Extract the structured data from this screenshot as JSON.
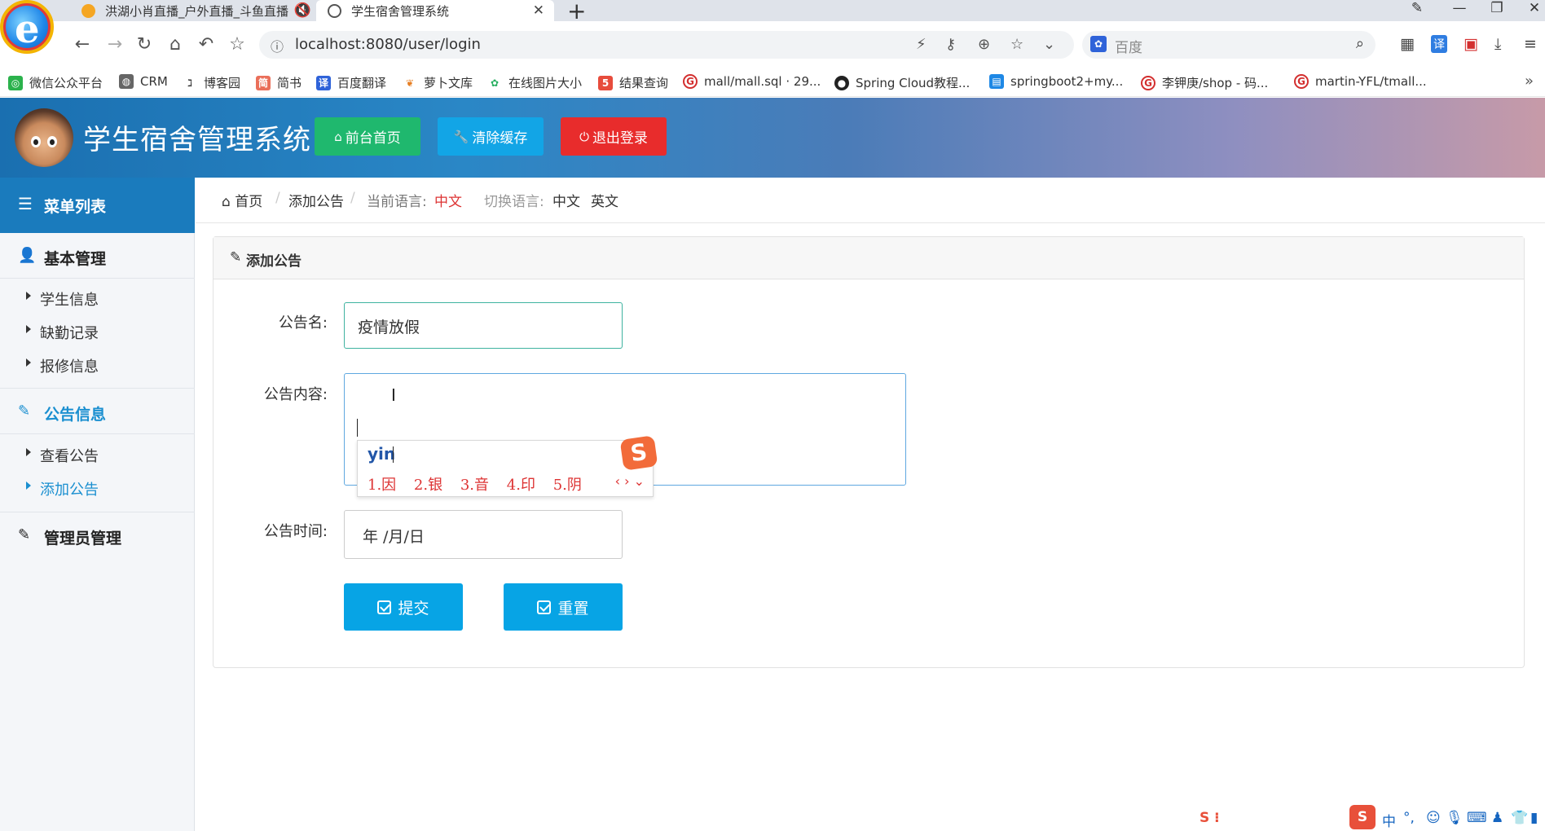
{
  "browser": {
    "tabs": [
      {
        "title": "洪湖小肖直播_户外直播_斗鱼直播",
        "active": false
      },
      {
        "title": "学生宿舍管理系统",
        "active": true
      }
    ],
    "new_tab": "+",
    "url": "localhost:8080/user/login",
    "search_placeholder": "百度",
    "bookmarks": [
      {
        "label": "微信公众平台",
        "icon_color": "#2bb24c"
      },
      {
        "label": "CRM",
        "icon_color": "#666666"
      },
      {
        "label": "博客园",
        "icon_color": "#555555"
      },
      {
        "label": "简书",
        "icon_color": "#ea6f5a"
      },
      {
        "label": "百度翻译",
        "icon_color": "#2f63d9"
      },
      {
        "label": "萝卜文库",
        "icon_color": "#e67e22"
      },
      {
        "label": "在线图片大小",
        "icon_color": "#27ae60"
      },
      {
        "label": "结果查询",
        "icon_color": "#e74c3c"
      },
      {
        "label": "mall/mall.sql · 29...",
        "icon_color": "#d32f2f"
      },
      {
        "label": "Spring Cloud教程...",
        "icon_color": "#222222"
      },
      {
        "label": "springboot2+my...",
        "icon_color": "#1e88e5"
      },
      {
        "label": "李钾庚/shop - 码...",
        "icon_color": "#d32f2f"
      },
      {
        "label": "martin-YFL/tmall...",
        "icon_color": "#d32f2f"
      }
    ],
    "bookmarks_more": "»"
  },
  "header": {
    "title": "学生宿舍管理系统",
    "buttons": [
      {
        "label": "前台首页",
        "color": "#1fb86e",
        "icon": "home-icon"
      },
      {
        "label": "清除缓存",
        "color": "#12a5e6",
        "icon": "wrench-icon"
      },
      {
        "label": "退出登录",
        "color": "#e82c2c",
        "icon": "power-icon"
      }
    ]
  },
  "sidebar": {
    "heading": "菜单列表",
    "groups": [
      {
        "label": "基本管理",
        "icon": "user-icon",
        "items": [
          "学生信息",
          "缺勤记录",
          "报修信息"
        ]
      },
      {
        "label": "公告信息",
        "icon": "edit-icon",
        "active": true,
        "items": [
          "查看公告",
          "添加公告"
        ],
        "active_item": "添加公告"
      },
      {
        "label": "管理员管理",
        "icon": "edit-icon",
        "items": []
      }
    ]
  },
  "breadcrumb": {
    "home": "首页",
    "current": "添加公告",
    "lang_label": "当前语言:",
    "lang_value": "中文",
    "switch_label": "切换语言:",
    "switch_zh": "中文",
    "switch_en": "英文"
  },
  "form": {
    "panel_title": "添加公告",
    "name_label": "公告名:",
    "name_value": "疫情放假",
    "content_label": "公告内容:",
    "content_value": "",
    "time_label": "公告时间:",
    "time_value": "年 /月/日",
    "submit_label": "提交",
    "reset_label": "重置"
  },
  "ime": {
    "composition": "yin",
    "candidates": [
      "1.因",
      "2.银",
      "3.音",
      "4.印",
      "5.阴"
    ],
    "logo": "S"
  },
  "tray": {
    "ime_mode": "中",
    "punct": "°,"
  }
}
